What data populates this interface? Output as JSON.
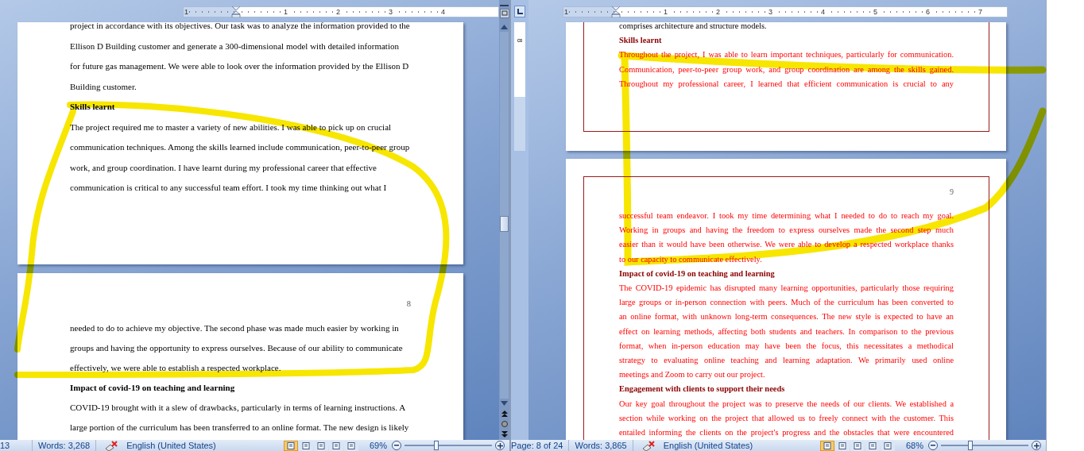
{
  "left_window": {
    "justified": false,
    "ruler": {
      "labels": [
        "1",
        "1",
        "2",
        "3",
        "4"
      ]
    },
    "pages": [
      {
        "blocks": [
          {
            "kind": "text",
            "lines": [
              "project in accordance with its objectives. Our task was to analyze the information provided to the",
              "Ellison D Building customer and generate a 300-dimensional model with detailed information",
              "for future gas management. We were able to look over the information provided by the Ellison D",
              "Building customer."
            ]
          },
          {
            "kind": "heading",
            "lines": [
              "Skills learnt"
            ]
          },
          {
            "kind": "text",
            "lines": [
              "The project required me to master a variety of new abilities. I was able to pick up on crucial",
              "communication techniques. Among the skills learned include communication, peer-to-peer group",
              "work, and group coordination. I have learnt during my professional career that effective",
              "communication is critical to any successful team effort. I took my time thinking out what I"
            ]
          }
        ]
      },
      {
        "page_number": "8",
        "blocks": [
          {
            "kind": "text",
            "lines": [
              "needed to do to achieve my objective. The second phase was made much easier by working in",
              "groups and having the opportunity to express ourselves. Because of our ability to communicate",
              "effectively, we were able to establish a respected workplace."
            ]
          },
          {
            "kind": "heading",
            "lines": [
              "Impact of covid-19 on teaching and learning"
            ]
          },
          {
            "kind": "text",
            "lines": [
              "COVID-19 brought with it a slew of drawbacks, particularly in terms of learning instructions. A",
              "large portion of the curriculum has been transferred to an online format. The new design is likely"
            ]
          }
        ]
      }
    ],
    "status_bar": {
      "page": "13",
      "words": "Words: 3,268",
      "language": "English (United States)",
      "view_buttons": [
        {
          "selected": true
        },
        {
          "selected": false
        },
        {
          "selected": false
        },
        {
          "selected": false
        },
        {
          "selected": false
        }
      ],
      "zoom": "69%",
      "zoom_slider": {
        "level": 0.36
      }
    }
  },
  "right_window": {
    "justified": true,
    "vertical_ruler": {
      "labels": [
        "8"
      ]
    },
    "ruler": {
      "labels": [
        "1",
        "1",
        "2",
        "3",
        "4",
        "5",
        "6",
        "7"
      ]
    },
    "pages": [
      {
        "page_border": true,
        "blocks": [
          {
            "kind": "text",
            "lines": [
              "comprises architecture and structure models."
            ]
          },
          {
            "kind": "tracked_heading",
            "lines": [
              "Skills learnt"
            ]
          },
          {
            "kind": "tracked_text",
            "continues": true,
            "lines": [
              "Throughout the project, I was able to learn important techniques, particularly for communication.",
              "Communication, peer-to-peer group work, and group coordination are among the skills gained.",
              "Throughout my professional career, I learned that efficient communication is crucial to any"
            ]
          }
        ]
      },
      {
        "page_border": true,
        "page_number": "9",
        "blocks": [
          {
            "kind": "tracked_text",
            "lines": [
              "successful team endeavor. I took my time determining what I needed to do to reach my goal.",
              "Working in groups and having the freedom to express ourselves made the second step much",
              "easier than it would have been otherwise. We were able to develop a respected workplace thanks",
              "to our capacity to communicate effectively."
            ]
          },
          {
            "kind": "tracked_heading",
            "lines": [
              "Impact of covid-19 on teaching and learning"
            ]
          },
          {
            "kind": "tracked_text",
            "lines": [
              "The COVID-19 epidemic has disrupted many learning opportunities, particularly those requiring",
              "large groups or in-person connection with peers. Much of the curriculum has been converted to",
              "an online format, with unknown long-term consequences. The new style is expected to have an",
              "effect on learning methods, affecting both students and teachers. In comparison to the previous",
              "format, when in-person education may have been the focus, this necessitates a methodical",
              "strategy to evaluating online teaching and learning adaptation. We primarily used online",
              "meetings and Zoom to carry out our project."
            ]
          },
          {
            "kind": "tracked_heading",
            "lines": [
              "Engagement with clients to support their needs"
            ]
          },
          {
            "kind": "tracked_text",
            "continues": true,
            "lines": [
              "Our key goal throughout the project was to preserve the needs of our clients. We established a",
              "section while working on the project that allowed us to freely connect with the customer. This",
              "entailed informing the clients on the project's progress and the obstacles that were encountered"
            ]
          }
        ]
      }
    ],
    "status_bar": {
      "page": "Page: 8 of 24",
      "words": "Words: 3,865",
      "language": "English (United States)",
      "view_buttons": [
        {
          "selected": true
        },
        {
          "selected": false
        },
        {
          "selected": false
        },
        {
          "selected": false
        },
        {
          "selected": false
        }
      ],
      "zoom": "68%",
      "zoom_slider": {
        "level": 0.34
      }
    }
  }
}
